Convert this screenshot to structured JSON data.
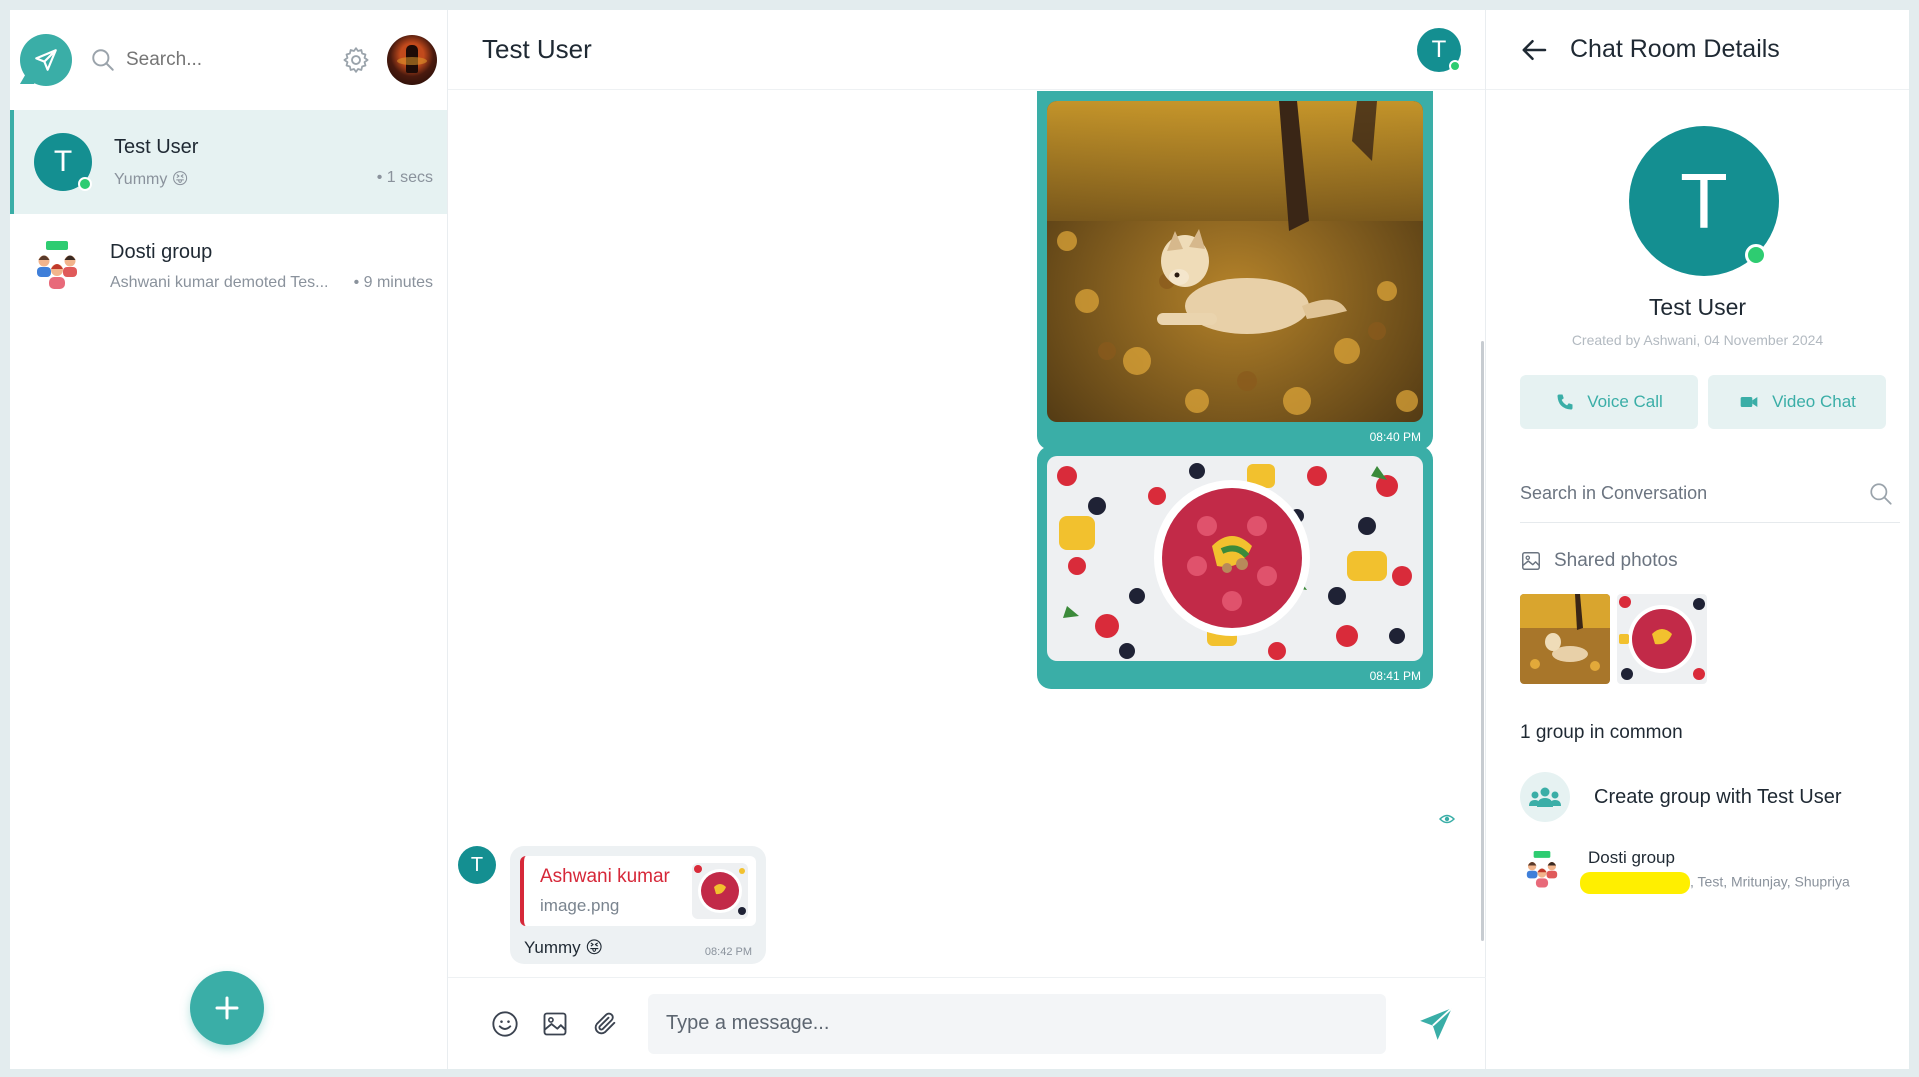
{
  "sidebar": {
    "search_placeholder": "Search...",
    "chats": [
      {
        "name": "Test User",
        "avatar_letter": "T",
        "last_message": "Yummy 😝",
        "time": "• 1 secs",
        "active": true,
        "online": true
      },
      {
        "name": "Dosti group",
        "last_message": "Ashwani kumar demoted Tes...",
        "time": "• 9 minutes",
        "active": false
      }
    ],
    "fab_label": "+"
  },
  "main": {
    "title": "Test User",
    "avatar_letter": "T",
    "messages": [
      {
        "type": "image",
        "subject": "dog-in-autumn-leaves",
        "time": "08:40 PM"
      },
      {
        "type": "image",
        "subject": "fruit-bowl",
        "time": "08:41 PM"
      }
    ],
    "received": {
      "avatar_letter": "T",
      "reply_to_name": "Ashwani kumar",
      "reply_to_file": "image.png",
      "text": "Yummy 😝",
      "time": "08:42 PM"
    },
    "composer_placeholder": "Type a message..."
  },
  "details": {
    "title": "Chat Room Details",
    "avatar_letter": "T",
    "name": "Test User",
    "created": "Created by Ashwani, 04 November 2024",
    "voice_call_label": "Voice Call",
    "video_chat_label": "Video Chat",
    "search_placeholder": "Search in Conversation",
    "shared_photos_label": "Shared photos",
    "common_label": "1 group in common",
    "create_group_label": "Create group with Test User",
    "group_name": "Dosti group",
    "group_members": ", Test, Mritunjay, Shupriya"
  },
  "colors": {
    "accent": "#3aaea7",
    "avatar": "#148f91",
    "online": "#2ecc71",
    "reply_accent": "#d62839",
    "highlight": "#ffef00"
  }
}
